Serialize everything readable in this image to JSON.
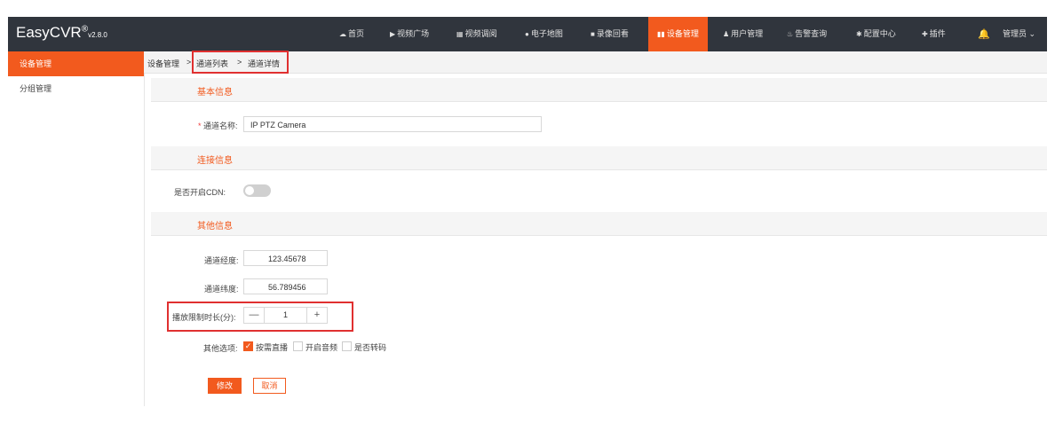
{
  "brand": {
    "name": "EasyCVR",
    "reg": "®",
    "version": "v2.8.0"
  },
  "nav": [
    {
      "icon": "☁",
      "icon_name": "dashboard-icon",
      "label": "首页"
    },
    {
      "icon": "▶",
      "icon_name": "play-circle-icon",
      "label": "视频广场"
    },
    {
      "icon": "▦",
      "icon_name": "grid-icon",
      "label": "视频调阅"
    },
    {
      "icon": "●",
      "icon_name": "map-pin-icon",
      "label": "电子地图"
    },
    {
      "icon": "■",
      "icon_name": "video-camera-icon",
      "label": "录像回看"
    },
    {
      "icon": "▮▮",
      "icon_name": "device-icon",
      "label": "设备管理"
    },
    {
      "icon": "♟",
      "icon_name": "user-icon",
      "label": "用户管理"
    },
    {
      "icon": "♨",
      "icon_name": "alarm-icon",
      "label": "告警查询"
    },
    {
      "icon": "✱",
      "icon_name": "gear-icon",
      "label": "配置中心"
    },
    {
      "icon": "✚",
      "icon_name": "plugin-icon",
      "label": "插件"
    }
  ],
  "user": {
    "label": "管理员 ⌄"
  },
  "sidebar": {
    "items": [
      {
        "label": "设备管理"
      },
      {
        "label": "分组管理"
      }
    ]
  },
  "breadcrumb": {
    "root": "设备管理",
    "sep1": ">",
    "list": "通道列表",
    "sep2": ">",
    "current": "通道详情"
  },
  "sections": {
    "basic": "基本信息",
    "connection": "连接信息",
    "other": "其他信息"
  },
  "form": {
    "required_mark": "*",
    "channel_name_label": "通道名称:",
    "channel_name_value": "IP PTZ Camera",
    "cdn_label": "是否开启CDN:",
    "longitude_label": "通道经度:",
    "longitude_value": "123.45678",
    "latitude_label": "通道纬度:",
    "latitude_value": "56.789456",
    "play_limit_label": "播放限制时长(分):",
    "play_limit_value": "1",
    "minus": "—",
    "plus": "+",
    "options_label": "其他选项:",
    "options": [
      {
        "label": "按需直播",
        "checked": true
      },
      {
        "label": "开启音频",
        "checked": false
      },
      {
        "label": "是否转码",
        "checked": false
      }
    ],
    "check_mark": "✓"
  },
  "actions": {
    "modify": "修改",
    "cancel": "取消"
  }
}
